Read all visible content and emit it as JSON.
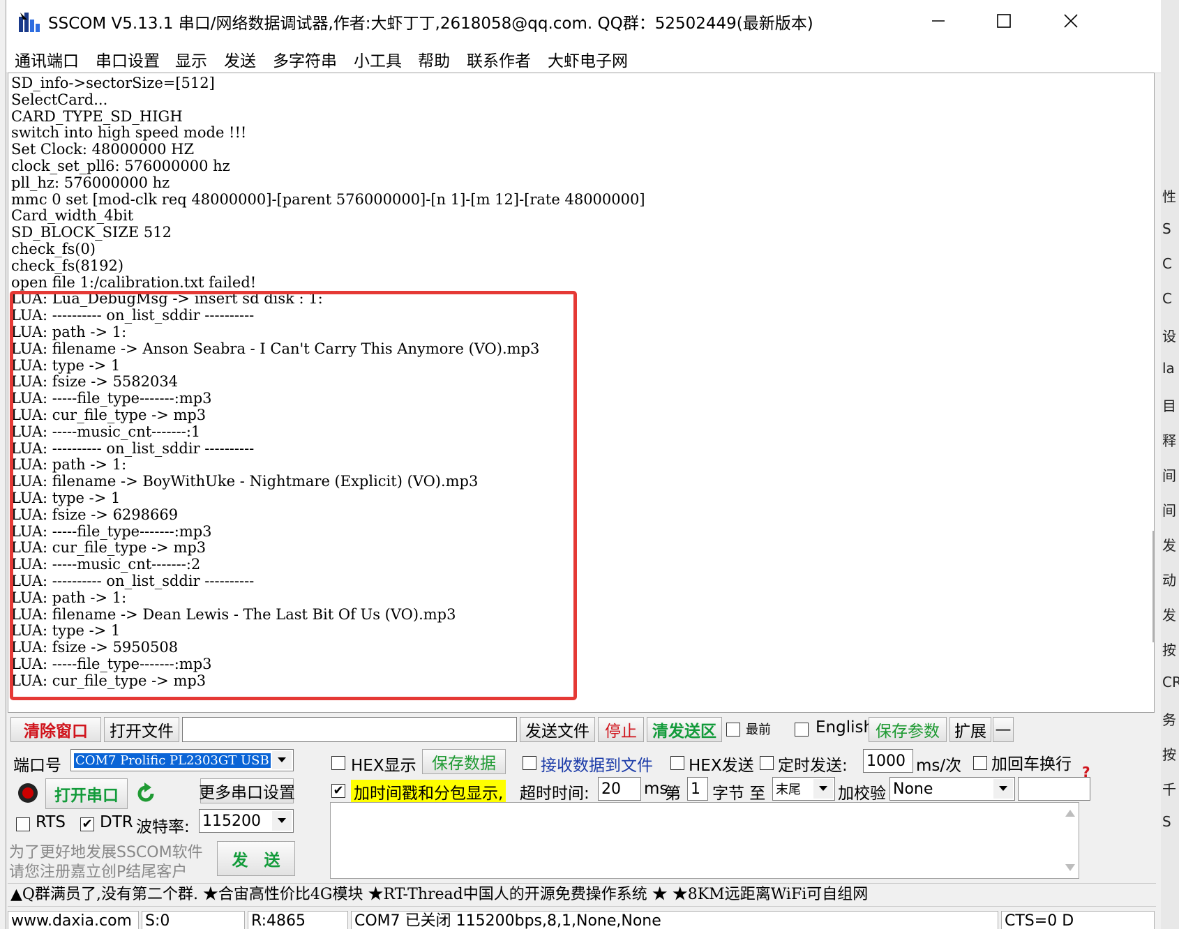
{
  "window": {
    "title": "SSCOM V5.13.1 串口/网络数据调试器,作者:大虾丁丁,2618058@qq.com. QQ群：52502449(最新版本)"
  },
  "menu": [
    "通讯端口",
    "串口设置",
    "显示",
    "发送",
    "多字符串",
    "小工具",
    "帮助",
    "联系作者",
    "大虾电子网"
  ],
  "log_lines": [
    "SD_info->sectorSize=[512]",
    "SelectCard...",
    "CARD_TYPE_SD_HIGH",
    "switch into high speed mode !!!",
    "Set Clock: 48000000 HZ",
    "clock_set_pll6: 576000000 hz",
    "pll_hz: 576000000 hz",
    "mmc 0 set [mod-clk req 48000000]-[parent 576000000]-[n 1]-[m 12]-[rate 48000000]",
    "Card_width_4bit",
    "SD_BLOCK_SIZE 512",
    "check_fs(0)",
    "check_fs(8192)",
    "open file 1:/calibration.txt failed!",
    "LUA: Lua_DebugMsg -> insert sd disk : 1:",
    "LUA: ---------- on_list_sddir ----------",
    "LUA: path -> 1:",
    "LUA: filename -> Anson Seabra - I Can't Carry This Anymore (VO).mp3",
    "LUA: type -> 1",
    "LUA: fsize -> 5582034",
    "LUA: -----file_type-------:mp3",
    "LUA: cur_file_type -> mp3",
    "LUA: -----music_cnt-------:1",
    "LUA: ---------- on_list_sddir ----------",
    "LUA: path -> 1:",
    "LUA: filename -> BoyWithUke - Nightmare (Explicit) (VO).mp3",
    "LUA: type -> 1",
    "LUA: fsize -> 6298669",
    "LUA: -----file_type-------:mp3",
    "LUA: cur_file_type -> mp3",
    "LUA: -----music_cnt-------:2",
    "LUA: ---------- on_list_sddir ----------",
    "LUA: path -> 1:",
    "LUA: filename -> Dean Lewis - The Last Bit Of Us (VO).mp3",
    "LUA: type -> 1",
    "LUA: fsize -> 5950508",
    "LUA: -----file_type-------:mp3",
    "LUA: cur_file_type -> mp3"
  ],
  "toolbar": {
    "clear_window": "清除窗口",
    "open_file": "打开文件",
    "file_path": "",
    "send_file": "发送文件",
    "stop": "停止",
    "clear_send_area": "清发送区",
    "topmost": "最前",
    "english": "English",
    "save_params": "保存参数",
    "expand": "扩展",
    "collapse": "—"
  },
  "port": {
    "port_label": "端口号",
    "port_value": "COM7 Prolific PL2303GT USB",
    "open_port": "打开串口",
    "more_settings": "更多串口设置",
    "rts": "RTS",
    "dtr": "DTR",
    "baud_label": "波特率:",
    "baud_value": "115200",
    "promo_line1": "为了更好地发展SSCOM软件",
    "promo_line2": "请您注册嘉立创P结尾客户",
    "send": "发　送"
  },
  "options": {
    "hex_display": "HEX显示",
    "save_data": "保存数据",
    "recv_to_file": "接收数据到文件",
    "hex_send": "HEX发送",
    "timed_send": "定时发送:",
    "interval_value": "1000",
    "interval_unit": "ms/次",
    "append_crlf": "加回车换行",
    "timestamp": "加时间戳和分包显示,",
    "timeout_label": "超时时间:",
    "timeout_value": "20",
    "timeout_unit": "ms",
    "byte_from_label": "第",
    "byte_from_value": "1",
    "byte_unit": "字节 至",
    "byte_to_value": "末尾",
    "checksum_label": "加校验",
    "checksum_value": "None"
  },
  "marquee": "▲Q群满员了,没有第二个群. ★合宙高性价比4G模块 ★RT-Thread中国人的开源免费操作系统 ★ ★8KM远距离WiFi可自组网",
  "status": {
    "website": "www.daxia.com",
    "sent": "S:0",
    "received": "R:4865",
    "port_status": "COM7 已关闭  115200bps,8,1,None,None",
    "cts": "CTS=0 D"
  },
  "right_strip_glyphs": [
    "性",
    "S",
    "C",
    "C",
    "设",
    "la",
    "目",
    "释",
    "间",
    "间",
    "发",
    "动",
    "发",
    "按",
    "CR",
    "务",
    "按",
    "千",
    "S"
  ]
}
